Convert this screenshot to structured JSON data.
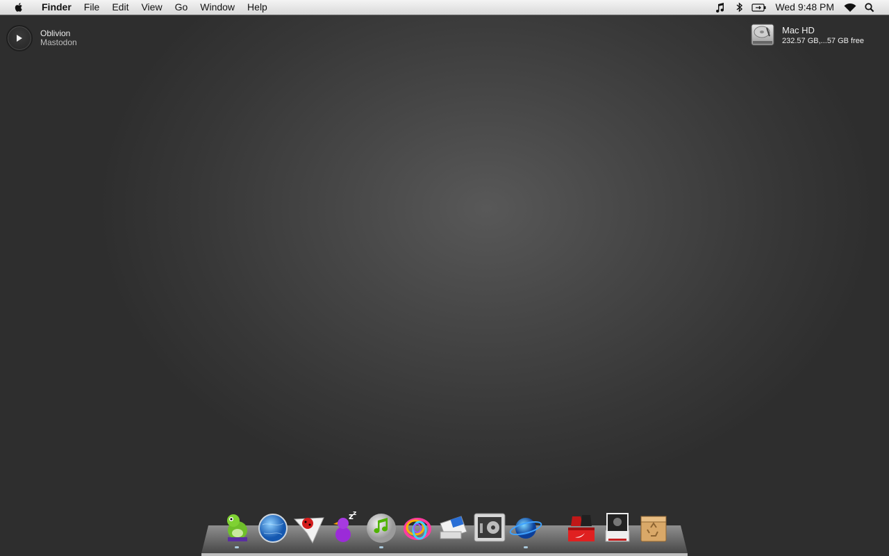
{
  "menubar": {
    "app_name": "Finder",
    "menus": [
      "File",
      "Edit",
      "View",
      "Go",
      "Window",
      "Help"
    ],
    "clock": "Wed 9:48 PM",
    "status_icons": [
      "itunes-note-icon",
      "bluetooth-icon",
      "battery-icon",
      "wifi-icon",
      "spotlight-search-icon"
    ]
  },
  "now_playing": {
    "title": "Oblivion",
    "artist": "Mastodon"
  },
  "disk": {
    "name": "Mac HD",
    "free": "232.57 GB,...57 GB free"
  },
  "dock": {
    "apps": [
      "adium-dino-icon",
      "safari-globe-icon",
      "tweetie-bird-icon",
      "purple-duck-icon",
      "itunes-icon",
      "colorful-rings-icon",
      "stamp-mail-icon",
      "system-preferences-icon",
      "planet-browser-icon"
    ],
    "stacks": [
      "sneakers-box-icon",
      "photo-stack-icon",
      "trash-box-icon"
    ]
  },
  "colors": {
    "menubar_top": "#f4f4f4",
    "menubar_bottom": "#d9d9d9",
    "desktop_center": "#585858",
    "desktop_edge": "#2e2e2e"
  }
}
